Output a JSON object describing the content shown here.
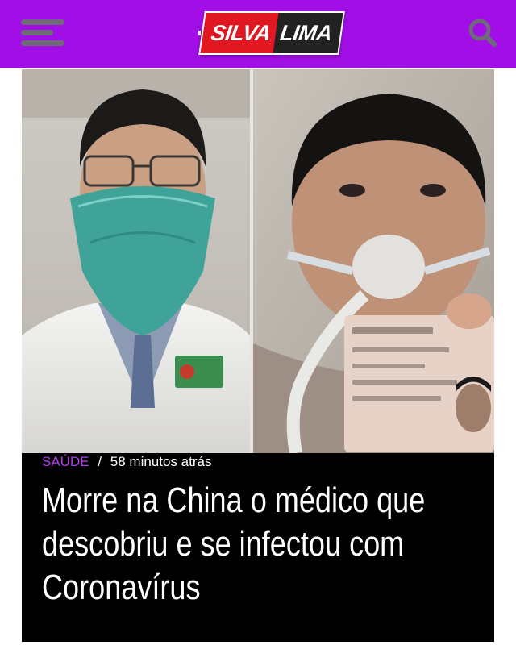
{
  "header": {
    "logo_part1": "SILVA",
    "logo_part2": "LIMA",
    "menu_icon": "hamburger-menu-icon",
    "search_icon": "search-icon",
    "bg_color": "#a20fe6"
  },
  "article": {
    "category": "SAÚDE",
    "separator": "/",
    "time": "58 minutos atrás",
    "headline": "Morre na China o médico que descobriu e se infectou com Coronavírus",
    "category_color": "#b33ff0"
  }
}
